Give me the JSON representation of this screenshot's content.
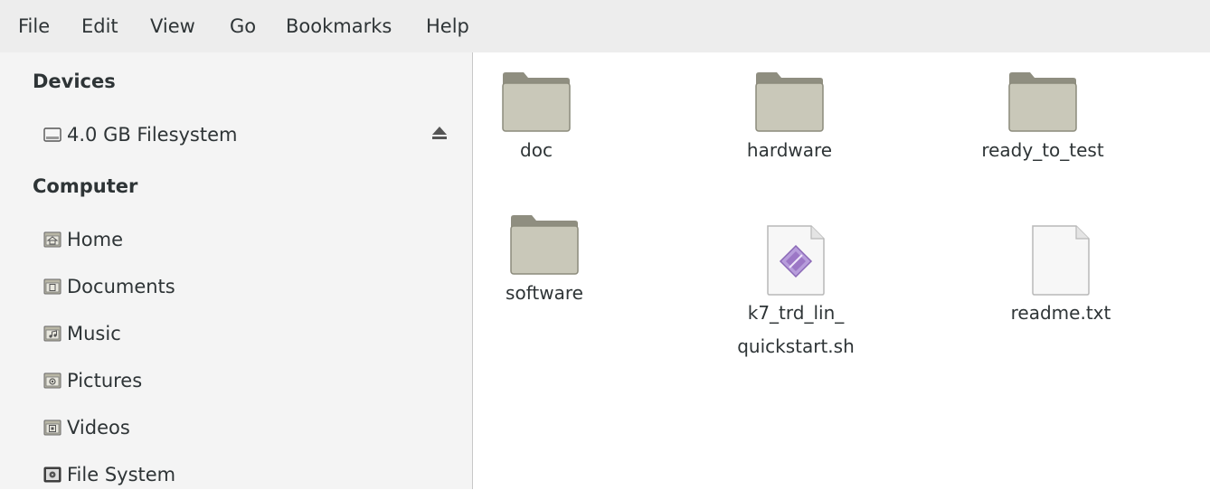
{
  "menubar": {
    "items": [
      "File",
      "Edit",
      "View",
      "Go",
      "Bookmarks",
      "Help"
    ]
  },
  "sidebar": {
    "devices_title": "Devices",
    "devices": [
      {
        "label": "4.0 GB Filesystem",
        "icon": "drive-icon"
      }
    ],
    "computer_title": "Computer",
    "places": [
      {
        "label": "Home",
        "icon": "home-folder-icon"
      },
      {
        "label": "Documents",
        "icon": "documents-folder-icon"
      },
      {
        "label": "Music",
        "icon": "music-folder-icon"
      },
      {
        "label": "Pictures",
        "icon": "pictures-folder-icon"
      },
      {
        "label": "Videos",
        "icon": "videos-folder-icon"
      },
      {
        "label": "File System",
        "icon": "filesystem-icon"
      }
    ]
  },
  "files": [
    {
      "name": "doc",
      "type": "folder"
    },
    {
      "name": "hardware",
      "type": "folder"
    },
    {
      "name": "ready_to_test",
      "type": "folder"
    },
    {
      "name": "software",
      "type": "folder"
    },
    {
      "name_line1": "k7_trd_lin_",
      "name_line2": "quickstart.sh",
      "type": "script"
    },
    {
      "name": "readme.txt",
      "type": "text"
    }
  ],
  "colors": {
    "menubar_bg": "#ededed",
    "sidebar_bg": "#f4f4f4",
    "folder_body": "#c9c8b9",
    "folder_tab": "#8f8e80",
    "script_accent": "#9c77c6"
  }
}
